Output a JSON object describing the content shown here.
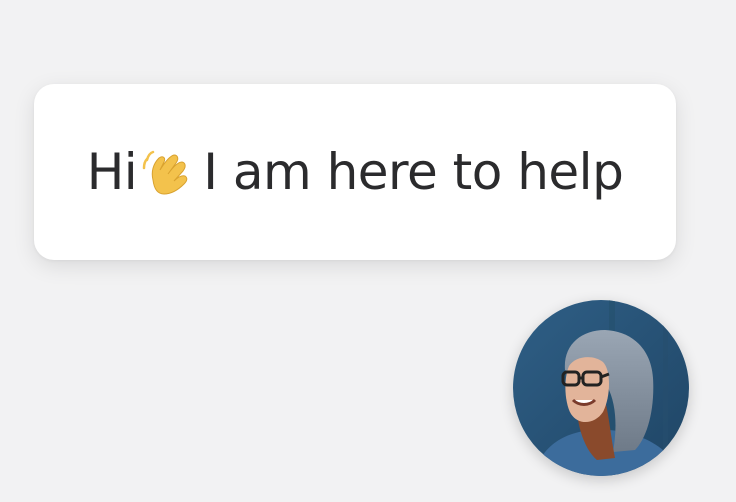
{
  "chat_widget": {
    "greeting_prefix": "Hi",
    "greeting_suffix": "I am here to help",
    "wave_icon": "waving-hand-icon",
    "avatar_icon": "support-agent-avatar",
    "colors": {
      "background": "#f2f2f3",
      "bubble": "#ffffff",
      "text": "#2b2b2d",
      "wave": "#f3c24c"
    }
  }
}
